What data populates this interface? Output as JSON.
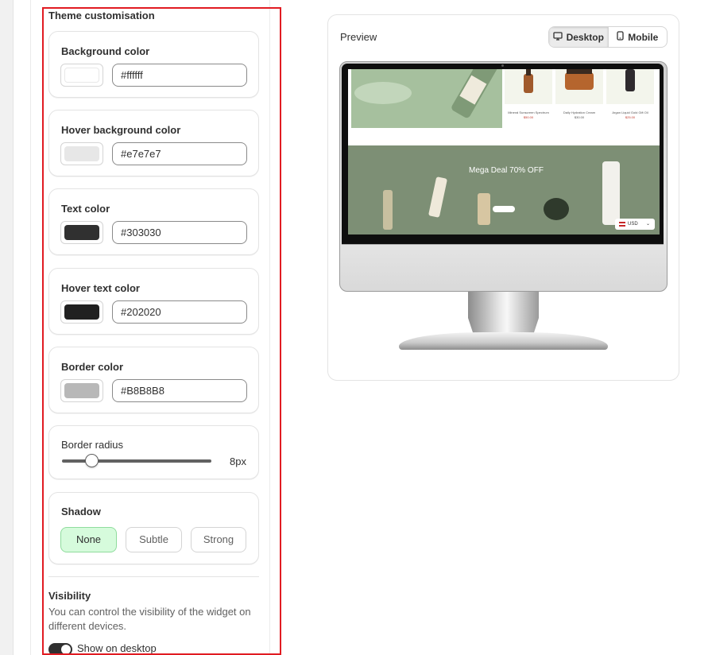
{
  "theme": {
    "section_title": "Theme customisation",
    "background_color": {
      "label": "Background color",
      "value": "#ffffff",
      "swatch": "#ffffff"
    },
    "hover_background_color": {
      "label": "Hover background color",
      "value": "#e7e7e7",
      "swatch": "#e7e7e7"
    },
    "text_color": {
      "label": "Text color",
      "value": "#303030",
      "swatch": "#303030"
    },
    "hover_text_color": {
      "label": "Hover text color",
      "value": "#202020",
      "swatch": "#202020"
    },
    "border_color": {
      "label": "Border color",
      "value": "#B8B8B8",
      "swatch": "#B8B8B8"
    },
    "border_radius": {
      "label": "Border radius",
      "value_label": "8px",
      "value": 8,
      "max": 40
    },
    "shadow": {
      "label": "Shadow",
      "options": [
        "None",
        "Subtle",
        "Strong"
      ],
      "selected": "None"
    }
  },
  "visibility": {
    "title": "Visibility",
    "description": "You can control the visibility of the widget on different devices.",
    "show_on_desktop_label": "Show on desktop",
    "show_on_desktop": true
  },
  "preview": {
    "label": "Preview",
    "desktop_label": "Desktop",
    "mobile_label": "Mobile",
    "active_device": "Desktop",
    "screen": {
      "products": [
        {
          "name": "Mineral Sunscreen Spectrum",
          "price": "$50.00"
        },
        {
          "name": "Daily Hydration Cream",
          "price": "$30.00"
        },
        {
          "name": "Argan Liquid Gold Gift Oil",
          "price": "$25.00"
        }
      ],
      "banner_title": "Mega Deal 70% OFF",
      "currency": "USD"
    }
  },
  "colors": {
    "accent_selected_bg": "#d6fbdc",
    "highlight_border": "#e11b22"
  }
}
